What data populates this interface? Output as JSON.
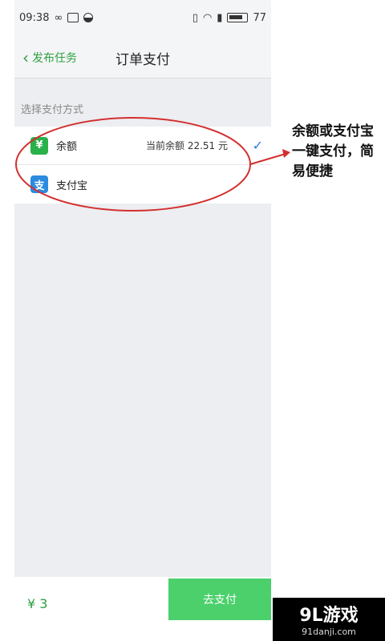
{
  "status_bar": {
    "time": "09:38",
    "battery": "77"
  },
  "nav": {
    "back_label": "发布任务",
    "title": "订单支付"
  },
  "section": {
    "label": "选择支付方式"
  },
  "payment_methods": [
    {
      "icon": "yen-icon",
      "label": "余额",
      "detail": "当前余额 22.51 元",
      "selected": true
    },
    {
      "icon": "alipay-icon",
      "label": "支付宝",
      "detail": "",
      "selected": false
    }
  ],
  "footer": {
    "price": "¥ 3",
    "pay_button": "去支付"
  },
  "annotation": {
    "text": "余额或支付宝一键支付，简易便捷"
  },
  "watermark": {
    "main": "9L游戏",
    "sub": "91danji.com"
  },
  "colors": {
    "accent_green": "#2ea043",
    "button_green": "#4bd06c",
    "check_blue": "#2b78e4",
    "annotation_red": "#d32f2f"
  }
}
